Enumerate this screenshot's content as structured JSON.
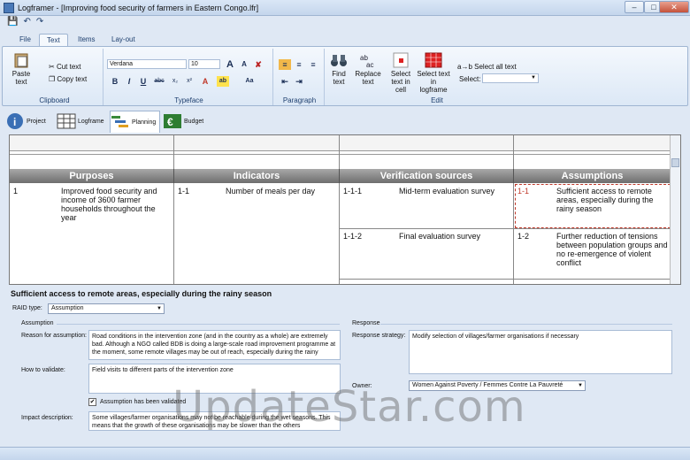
{
  "window": {
    "title": "Logframer - [Improving food security of farmers in Eastern Congo.lfr]"
  },
  "qat": {
    "save": "💾",
    "undo": "↶",
    "redo": "↷"
  },
  "tabs": [
    {
      "label": "File"
    },
    {
      "label": "Text"
    },
    {
      "label": "Items"
    },
    {
      "label": "Lay-out"
    }
  ],
  "ribbon": {
    "clipboard": {
      "label": "Clipboard",
      "paste": "Paste text",
      "cut": "Cut text",
      "copy": "Copy text"
    },
    "typeface": {
      "label": "Typeface",
      "font": "Verdana",
      "size": "10",
      "bold": "B",
      "italic": "I",
      "underline": "U",
      "strike": "abc",
      "sub": "x₂",
      "sup": "x²",
      "color": "A",
      "highlight": "ab",
      "case": "Aa"
    },
    "paragraph": {
      "label": "Paragraph"
    },
    "edit": {
      "label": "Edit",
      "find": "Find text",
      "replace": "Replace text",
      "select_cell": "Select text in cell",
      "select_logframe": "Select text in logframe",
      "select_all": "Select all text",
      "select_label": "Select:"
    }
  },
  "views": [
    {
      "label": "Project"
    },
    {
      "label": "Logframe"
    },
    {
      "label": "Planning"
    },
    {
      "label": "Budget"
    }
  ],
  "grid": {
    "headers": [
      "Purposes",
      "Indicators",
      "Verification sources",
      "Assumptions"
    ],
    "purpose": {
      "num": "1",
      "text": "Improved food security and income of 3600 farmer households throughout the year"
    },
    "indicator": {
      "num": "1-1",
      "text": "Number of meals per day"
    },
    "sources": [
      {
        "num": "1-1-1",
        "text": "Mid-term evaluation survey"
      },
      {
        "num": "1-1-2",
        "text": "Final evaluation survey"
      }
    ],
    "assumptions": [
      {
        "num": "1-1",
        "text": "Sufficient access to remote areas, especially during the rainy season"
      },
      {
        "num": "1-2",
        "text": "Further reduction of tensions between population groups and no re-emergence of violent conflict"
      }
    ]
  },
  "detail": {
    "title": "Sufficient access to remote areas, especially during the rainy season",
    "raid_label": "RAID type:",
    "raid_value": "Assumption",
    "assumption_section": "Assumption",
    "response_section": "Response",
    "reason_label": "Reason for assumption:",
    "reason_text": "Road conditions in the intervention zone (and in the country as a whole) are extremely bad. Although a NGO called BDB is doing a large-scale road improvement programme at the moment, some remote villages may be out of reach, especially during the rainy",
    "validate_label": "How to validate:",
    "validate_text": "Field visits to different parts of the intervention zone",
    "validated_label": "Assumption has been validated",
    "validated_check": "✔",
    "impact_label": "Impact description:",
    "impact_text": "Some villages/farmer organisations may not be reachable during the wet seasons. This means that the growth of these organisations may be slower than the others",
    "strategy_label": "Response strategy:",
    "strategy_text": "Modify selection of villages/farmer organisations if necessary",
    "owner_label": "Owner:",
    "owner_value": "Women Against Poverty / Femmes Contre La Pauvreté"
  },
  "watermark": "UpdateStar.com",
  "colors": {
    "header_gray": "#7a7a7a",
    "selection_red": "#c0392b",
    "accent": "#1e3f6e"
  }
}
